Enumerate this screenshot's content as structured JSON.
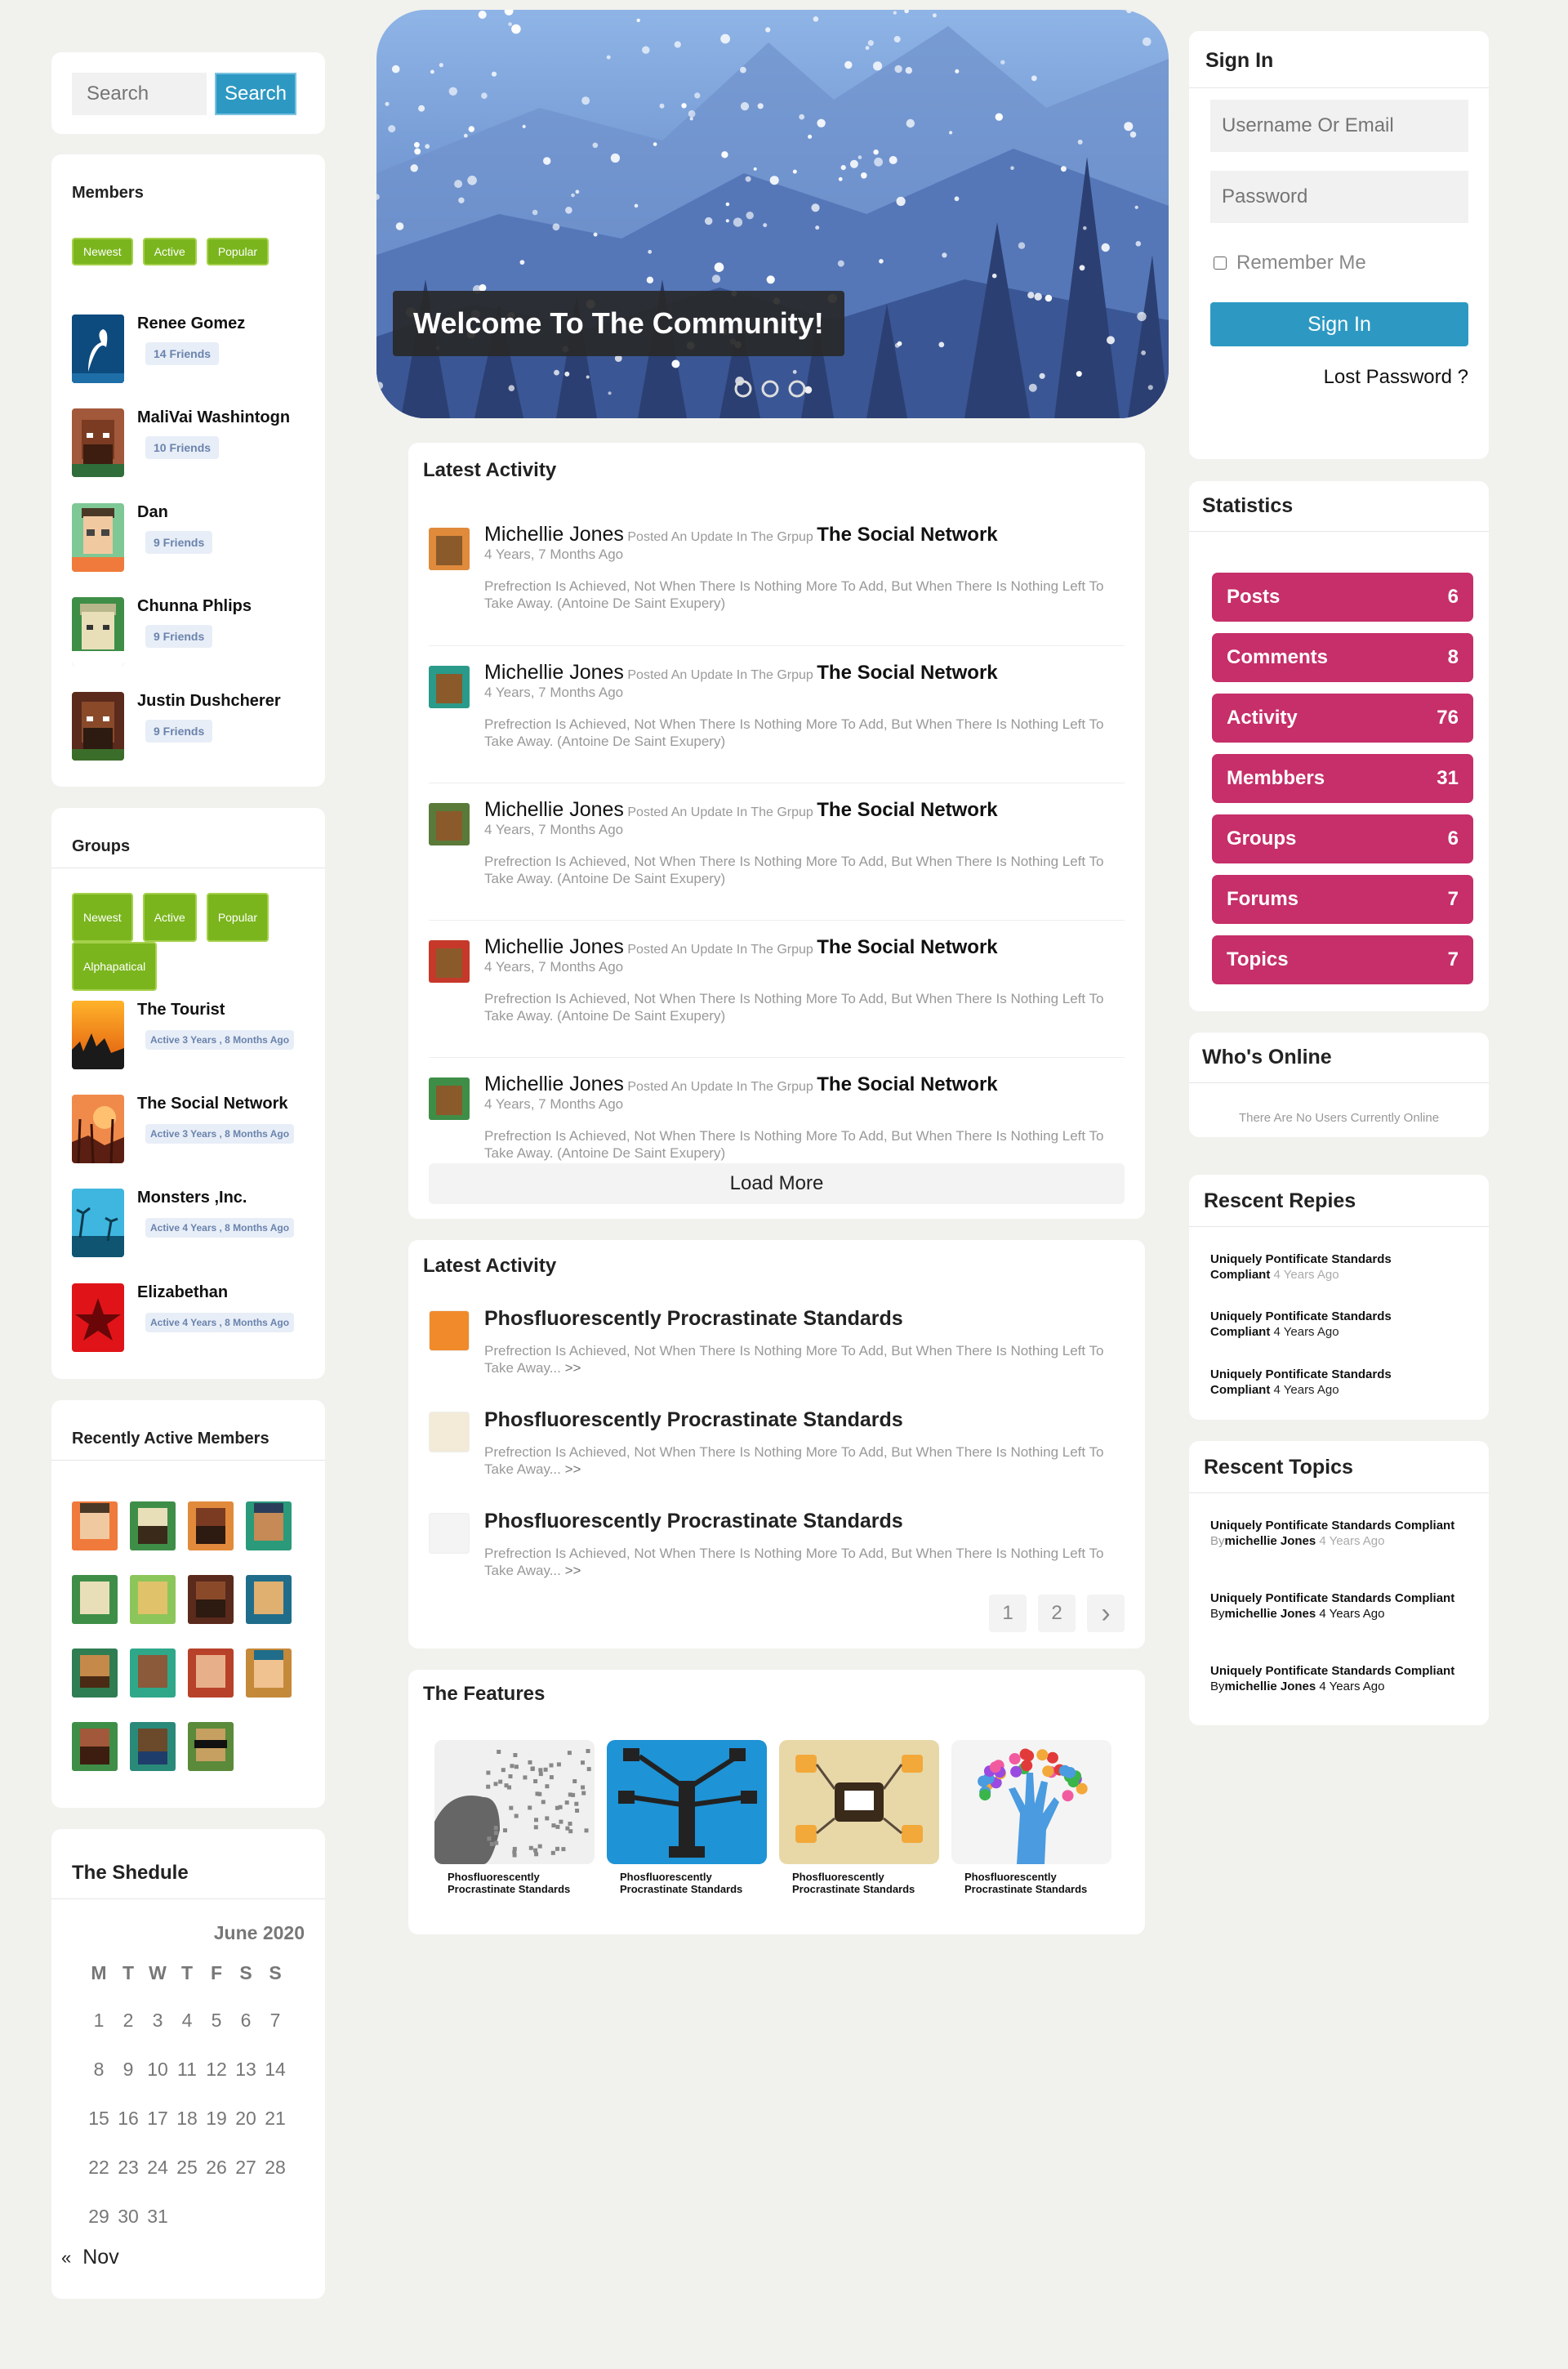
{
  "search": {
    "placeholder": "Search",
    "button": "Search"
  },
  "members": {
    "title": "Members",
    "tabs": [
      "Newest",
      "Active",
      "Popular"
    ],
    "items": [
      {
        "name": "Renee Gomez",
        "badge": "14 Friends"
      },
      {
        "name": "MaliVai Washintogn",
        "badge": "10 Friends"
      },
      {
        "name": "Dan",
        "badge": "9 Friends"
      },
      {
        "name": "Chunna Phlips",
        "badge": "9 Friends"
      },
      {
        "name": "Justin Dushcherer",
        "badge": "9 Friends"
      }
    ]
  },
  "groups": {
    "title": "Groups",
    "tabs": [
      "Newest",
      "Active",
      "Popular",
      "Alphapatical"
    ],
    "items": [
      {
        "name": "The Tourist",
        "badge": "Active 3 Years , 8 Months Ago"
      },
      {
        "name": "The Social Network",
        "badge": "Active 3 Years , 8 Months Ago"
      },
      {
        "name": "Monsters ,Inc.",
        "badge": "Active 4 Years , 8 Months Ago"
      },
      {
        "name": "Elizabethan",
        "badge": "Active 4 Years , 8 Months Ago"
      }
    ]
  },
  "recent_members": {
    "title": "Recently Active Members"
  },
  "schedule": {
    "title": "The Shedule",
    "month": "June 2020",
    "weekdays": [
      "M",
      "T",
      "W",
      "T",
      "F",
      "S",
      "S"
    ],
    "weeks": [
      [
        "1",
        "2",
        "3",
        "4",
        "5",
        "6",
        "7"
      ],
      [
        "8",
        "9",
        "10",
        "11",
        "12",
        "13",
        "14"
      ],
      [
        "15",
        "16",
        "17",
        "18",
        "19",
        "20",
        "21"
      ],
      [
        "22",
        "23",
        "24",
        "25",
        "26",
        "27",
        "28"
      ],
      [
        "29",
        "30",
        "31",
        "",
        "",
        "",
        ""
      ]
    ],
    "prev_arrow": "«",
    "prev_label": "Nov"
  },
  "hero": {
    "caption": "Welcome To The Community!"
  },
  "activity": {
    "title": "Latest Activity",
    "items": [
      {
        "user": "Michellie Jones",
        "action": "Posted An Update In The Grpup",
        "group": "The Social Network",
        "time": "4 Years, 7 Months Ago",
        "text": "Prefrection Is Achieved, Not When There Is Nothing More To Add, But When There Is Nothing Left To Take Away. (Antoine De Saint Exupery)"
      },
      {
        "user": "Michellie Jones",
        "action": "Posted An Update In The Grpup",
        "group": "The Social Network",
        "time": "4 Years, 7 Months Ago",
        "text": "Prefrection Is Achieved, Not When There Is Nothing More To Add, But When There Is Nothing Left To Take Away. (Antoine De Saint Exupery)"
      },
      {
        "user": "Michellie Jones",
        "action": "Posted An Update In The Grpup",
        "group": "The Social Network",
        "time": "4 Years, 7 Months Ago",
        "text": "Prefrection Is Achieved, Not When There Is Nothing More To Add, But When There Is Nothing Left To Take Away. (Antoine De Saint Exupery)"
      },
      {
        "user": "Michellie Jones",
        "action": "Posted An Update In The Grpup",
        "group": "The Social Network",
        "time": "4 Years, 7 Months Ago",
        "text": "Prefrection Is Achieved, Not When There Is Nothing More To Add, But When There Is Nothing Left To Take Away. (Antoine De Saint Exupery)"
      },
      {
        "user": "Michellie Jones",
        "action": "Posted An Update In The Grpup",
        "group": "The Social Network",
        "time": "4 Years, 7 Months Ago",
        "text": "Prefrection Is Achieved, Not When There Is Nothing More To Add, But When There Is Nothing Left To Take Away. (Antoine De Saint Exupery)"
      }
    ],
    "load_more": "Load More"
  },
  "activity2": {
    "title": "Latest Activity",
    "items": [
      {
        "title": "Phosfluorescently Procrastinate Standards",
        "text": "Prefrection Is Achieved, Not When There Is Nothing More To Add, But When There Is Nothing Left To Take Away...",
        "more": ">>"
      },
      {
        "title": "Phosfluorescently Procrastinate Standards",
        "text": "Prefrection Is Achieved, Not When There Is Nothing More To Add, But When There Is Nothing Left To Take Away...",
        "more": ">>"
      },
      {
        "title": "Phosfluorescently Procrastinate Standards",
        "text": "Prefrection Is Achieved, Not When There Is Nothing More To Add, But When There Is Nothing Left To Take Away...",
        "more": ">>"
      }
    ],
    "pages": [
      "1",
      "2"
    ],
    "next": "›"
  },
  "features": {
    "title": "The Features",
    "caption": "Phosfluorescently Procrastinate Standards"
  },
  "signin": {
    "title": "Sign In",
    "username_placeholder": "Username Or Email",
    "password_placeholder": "Password",
    "remember": "Remember Me",
    "button": "Sign In",
    "lost": "Lost Password ?"
  },
  "statistics": {
    "title": "Statistics",
    "items": [
      {
        "label": "Posts",
        "value": "6"
      },
      {
        "label": "Comments",
        "value": "8"
      },
      {
        "label": "Activity",
        "value": "76"
      },
      {
        "label": "Membbers",
        "value": "31"
      },
      {
        "label": "Groups",
        "value": "6"
      },
      {
        "label": "Forums",
        "value": "7"
      },
      {
        "label": "Topics",
        "value": "7"
      }
    ]
  },
  "whos_online": {
    "title": "Who's Online",
    "text": "There Are No Users Currently Online"
  },
  "recent_replies": {
    "title": "Rescent Repies",
    "items": [
      {
        "title": "Uniquely Pontificate Standards Compliant",
        "time": "4 Years Ago"
      },
      {
        "title": "Uniquely Pontificate Standards Compliant",
        "time": "4 Years Ago"
      },
      {
        "title": "Uniquely Pontificate Standards Compliant",
        "time": "4 Years Ago"
      }
    ]
  },
  "recent_topics": {
    "title": "Rescent Topics",
    "items": [
      {
        "title": "Uniquely Pontificate Standards Compliant",
        "by": "By",
        "author": "michellie Jones",
        "time": "4 Years Ago"
      },
      {
        "title": "Uniquely Pontificate Standards Compliant",
        "by": "By",
        "author": "michellie Jones",
        "time": "4 Years Ago"
      },
      {
        "title": "Uniquely Pontificate Standards Compliant",
        "by": "By",
        "author": "michellie Jones",
        "time": "4 Years Ago"
      }
    ]
  },
  "colors": {
    "accent": "#2d99c3",
    "tag": "#7ab51d",
    "stat": "#c62f69",
    "bg": "#f1f1ed"
  }
}
